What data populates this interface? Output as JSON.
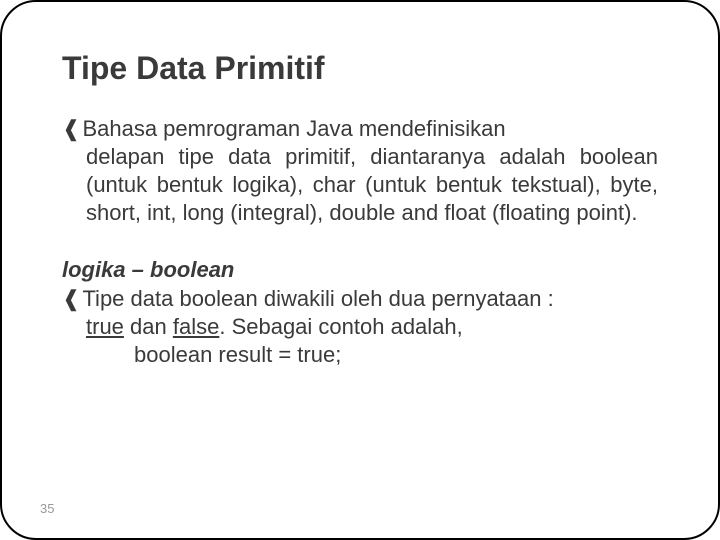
{
  "title": "Tipe Data Primitif",
  "bullet1": {
    "firstLine": "Bahasa pemrograman Java mendefinisikan",
    "rest": "delapan tipe data primitif, diantaranya adalah boolean (untuk bentuk logika), char (untuk bentuk tekstual), byte, short, int, long (integral), double and float (floating point)."
  },
  "subheading": "logika – boolean",
  "bullet2": {
    "firstLine": "Tipe data boolean diwakili oleh dua pernyataan :",
    "line2a": "true",
    "line2b": " dan ",
    "line2c": "false",
    "line2d": ". Sebagai contoh adalah,",
    "line3": "boolean result = true;"
  },
  "pageNumber": "35",
  "bulletGlyph": "❰"
}
